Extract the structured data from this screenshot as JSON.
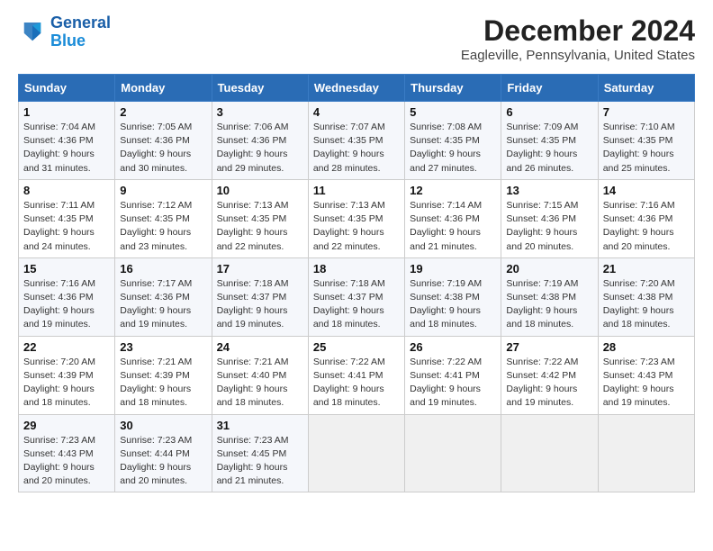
{
  "header": {
    "logo_line1": "General",
    "logo_line2": "Blue",
    "month": "December 2024",
    "location": "Eagleville, Pennsylvania, United States"
  },
  "days_of_week": [
    "Sunday",
    "Monday",
    "Tuesday",
    "Wednesday",
    "Thursday",
    "Friday",
    "Saturday"
  ],
  "weeks": [
    [
      {
        "day": 1,
        "info": "Sunrise: 7:04 AM\nSunset: 4:36 PM\nDaylight: 9 hours\nand 31 minutes."
      },
      {
        "day": 2,
        "info": "Sunrise: 7:05 AM\nSunset: 4:36 PM\nDaylight: 9 hours\nand 30 minutes."
      },
      {
        "day": 3,
        "info": "Sunrise: 7:06 AM\nSunset: 4:36 PM\nDaylight: 9 hours\nand 29 minutes."
      },
      {
        "day": 4,
        "info": "Sunrise: 7:07 AM\nSunset: 4:35 PM\nDaylight: 9 hours\nand 28 minutes."
      },
      {
        "day": 5,
        "info": "Sunrise: 7:08 AM\nSunset: 4:35 PM\nDaylight: 9 hours\nand 27 minutes."
      },
      {
        "day": 6,
        "info": "Sunrise: 7:09 AM\nSunset: 4:35 PM\nDaylight: 9 hours\nand 26 minutes."
      },
      {
        "day": 7,
        "info": "Sunrise: 7:10 AM\nSunset: 4:35 PM\nDaylight: 9 hours\nand 25 minutes."
      }
    ],
    [
      {
        "day": 8,
        "info": "Sunrise: 7:11 AM\nSunset: 4:35 PM\nDaylight: 9 hours\nand 24 minutes."
      },
      {
        "day": 9,
        "info": "Sunrise: 7:12 AM\nSunset: 4:35 PM\nDaylight: 9 hours\nand 23 minutes."
      },
      {
        "day": 10,
        "info": "Sunrise: 7:13 AM\nSunset: 4:35 PM\nDaylight: 9 hours\nand 22 minutes."
      },
      {
        "day": 11,
        "info": "Sunrise: 7:13 AM\nSunset: 4:35 PM\nDaylight: 9 hours\nand 22 minutes."
      },
      {
        "day": 12,
        "info": "Sunrise: 7:14 AM\nSunset: 4:36 PM\nDaylight: 9 hours\nand 21 minutes."
      },
      {
        "day": 13,
        "info": "Sunrise: 7:15 AM\nSunset: 4:36 PM\nDaylight: 9 hours\nand 20 minutes."
      },
      {
        "day": 14,
        "info": "Sunrise: 7:16 AM\nSunset: 4:36 PM\nDaylight: 9 hours\nand 20 minutes."
      }
    ],
    [
      {
        "day": 15,
        "info": "Sunrise: 7:16 AM\nSunset: 4:36 PM\nDaylight: 9 hours\nand 19 minutes."
      },
      {
        "day": 16,
        "info": "Sunrise: 7:17 AM\nSunset: 4:36 PM\nDaylight: 9 hours\nand 19 minutes."
      },
      {
        "day": 17,
        "info": "Sunrise: 7:18 AM\nSunset: 4:37 PM\nDaylight: 9 hours\nand 19 minutes."
      },
      {
        "day": 18,
        "info": "Sunrise: 7:18 AM\nSunset: 4:37 PM\nDaylight: 9 hours\nand 18 minutes."
      },
      {
        "day": 19,
        "info": "Sunrise: 7:19 AM\nSunset: 4:38 PM\nDaylight: 9 hours\nand 18 minutes."
      },
      {
        "day": 20,
        "info": "Sunrise: 7:19 AM\nSunset: 4:38 PM\nDaylight: 9 hours\nand 18 minutes."
      },
      {
        "day": 21,
        "info": "Sunrise: 7:20 AM\nSunset: 4:38 PM\nDaylight: 9 hours\nand 18 minutes."
      }
    ],
    [
      {
        "day": 22,
        "info": "Sunrise: 7:20 AM\nSunset: 4:39 PM\nDaylight: 9 hours\nand 18 minutes."
      },
      {
        "day": 23,
        "info": "Sunrise: 7:21 AM\nSunset: 4:39 PM\nDaylight: 9 hours\nand 18 minutes."
      },
      {
        "day": 24,
        "info": "Sunrise: 7:21 AM\nSunset: 4:40 PM\nDaylight: 9 hours\nand 18 minutes."
      },
      {
        "day": 25,
        "info": "Sunrise: 7:22 AM\nSunset: 4:41 PM\nDaylight: 9 hours\nand 18 minutes."
      },
      {
        "day": 26,
        "info": "Sunrise: 7:22 AM\nSunset: 4:41 PM\nDaylight: 9 hours\nand 19 minutes."
      },
      {
        "day": 27,
        "info": "Sunrise: 7:22 AM\nSunset: 4:42 PM\nDaylight: 9 hours\nand 19 minutes."
      },
      {
        "day": 28,
        "info": "Sunrise: 7:23 AM\nSunset: 4:43 PM\nDaylight: 9 hours\nand 19 minutes."
      }
    ],
    [
      {
        "day": 29,
        "info": "Sunrise: 7:23 AM\nSunset: 4:43 PM\nDaylight: 9 hours\nand 20 minutes."
      },
      {
        "day": 30,
        "info": "Sunrise: 7:23 AM\nSunset: 4:44 PM\nDaylight: 9 hours\nand 20 minutes."
      },
      {
        "day": 31,
        "info": "Sunrise: 7:23 AM\nSunset: 4:45 PM\nDaylight: 9 hours\nand 21 minutes."
      },
      null,
      null,
      null,
      null
    ]
  ]
}
